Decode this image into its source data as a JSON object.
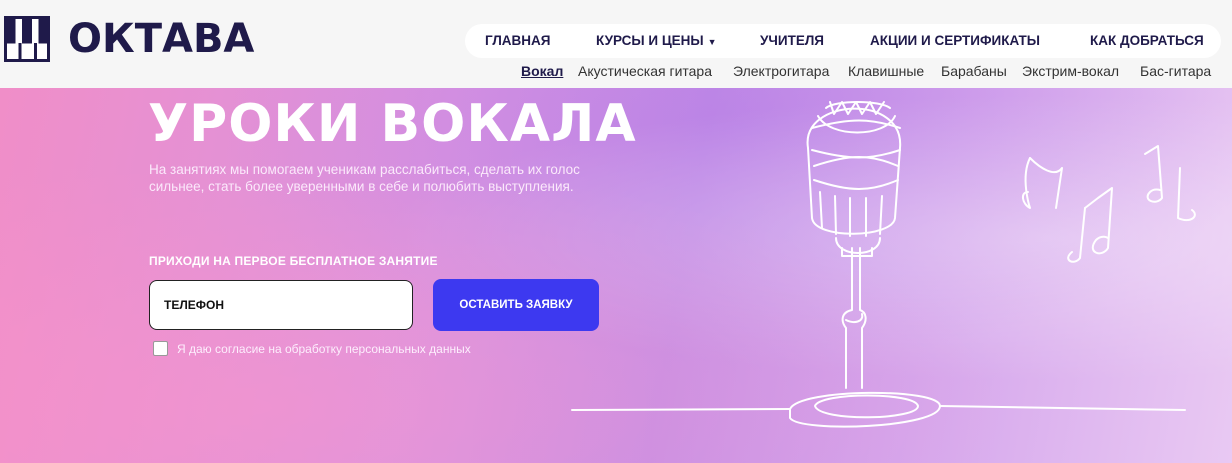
{
  "brand": {
    "name": "ОКТАВА"
  },
  "nav": {
    "items": [
      {
        "label": "ГЛАВНАЯ"
      },
      {
        "label": "КУРСЫ И ЦЕНЫ"
      },
      {
        "label": "УЧИТЕЛЯ"
      },
      {
        "label": "АКЦИИ И СЕРТИФИКАТЫ"
      },
      {
        "label": "КАК ДОБРАТЬСЯ"
      }
    ],
    "dropdown_icon": "chevron-down-icon"
  },
  "subnav": {
    "items": [
      {
        "label": "Вокал"
      },
      {
        "label": "Акустическая гитара"
      },
      {
        "label": "Электрогитара"
      },
      {
        "label": "Клавишные"
      },
      {
        "label": "Барабаны"
      },
      {
        "label": "Экстрим-вокал"
      },
      {
        "label": "Бас-гитара"
      }
    ],
    "active": "Вокал"
  },
  "hero": {
    "title": "УРОКИ ВОКАЛА",
    "description": "На занятиях мы помогаем ученикам расслабиться, сделать их голос сильнее, стать более уверенными в себе и полюбить выступления.",
    "cta_label": "ПРИХОДИ НА ПЕРВОЕ БЕСПЛАТНОЕ ЗАНЯТИЕ",
    "phone_placeholder": "ТЕЛЕФОН",
    "submit_label": "ОСТАВИТЬ ЗАЯВКУ",
    "consent_label": "Я даю согласие на обработку персональных данных",
    "consent_checked": false
  },
  "colors": {
    "brand_dark": "#1f1a4a",
    "accent_button": "#3d39f0",
    "hero_gradient_start": "#f08ec8",
    "hero_gradient_end": "#e9c9f3"
  },
  "icons": {
    "logo": "piano-keys-icon",
    "microphone": "microphone-illustration",
    "notes": "music-notes-icon"
  }
}
